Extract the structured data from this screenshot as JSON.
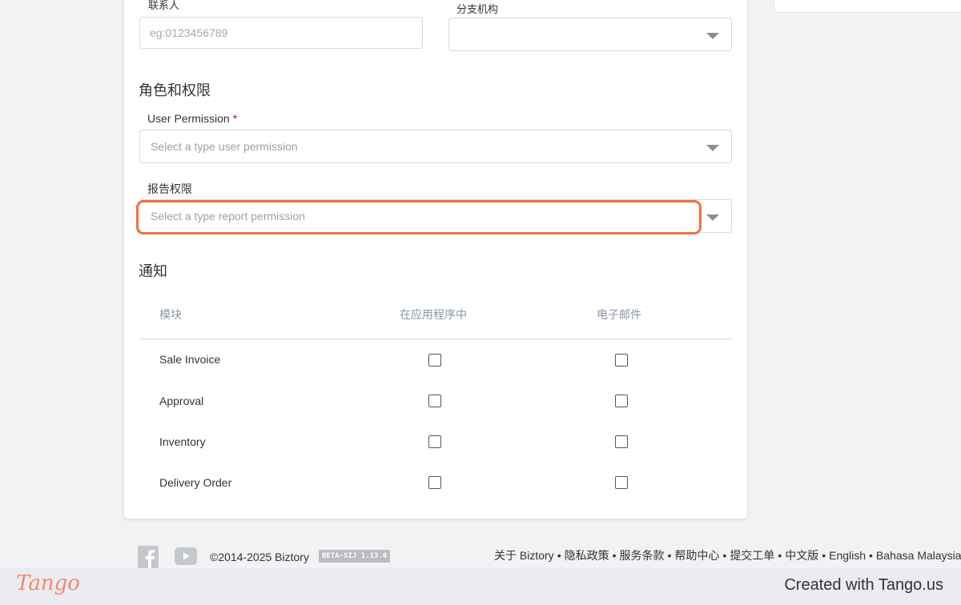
{
  "form": {
    "contact_label": "联系人",
    "contact_placeholder": "eg:0123456789",
    "branch_label": "分支机构",
    "roles_title": "角色和权限",
    "user_permission_label": "User Permission",
    "required_mark": "*",
    "user_permission_placeholder": "Select a type user permission",
    "report_permission_label": "报告权限",
    "report_permission_placeholder": "Select a type report permission"
  },
  "notifications": {
    "title": "通知",
    "columns": [
      "模块",
      "在应用程序中",
      "电子邮件"
    ],
    "rows": [
      {
        "module": "Sale Invoice",
        "in_app": false,
        "email": false
      },
      {
        "module": "Approval",
        "in_app": false,
        "email": false
      },
      {
        "module": "Inventory",
        "in_app": false,
        "email": false
      },
      {
        "module": "Delivery Order",
        "in_app": false,
        "email": false
      }
    ]
  },
  "footer": {
    "copyright": "©2014-2025 Biztory",
    "version_badge": "BETA-SIJ 1.13.0",
    "links": [
      "关于 Biztory",
      "隐私政策",
      "服务条款",
      "帮助中心",
      "提交工单",
      "中文版",
      "English",
      "Bahasa Malaysia"
    ],
    "separator": "•",
    "icons": [
      "facebook-icon",
      "youtube-icon"
    ]
  },
  "tango": {
    "logo": "Tango",
    "created_with": "Created with Tango.us"
  },
  "colors": {
    "highlight": "#f36f3c",
    "header_text": "#8a95a8",
    "required": "#d0021b",
    "tango_logo": "#f08a6e"
  }
}
